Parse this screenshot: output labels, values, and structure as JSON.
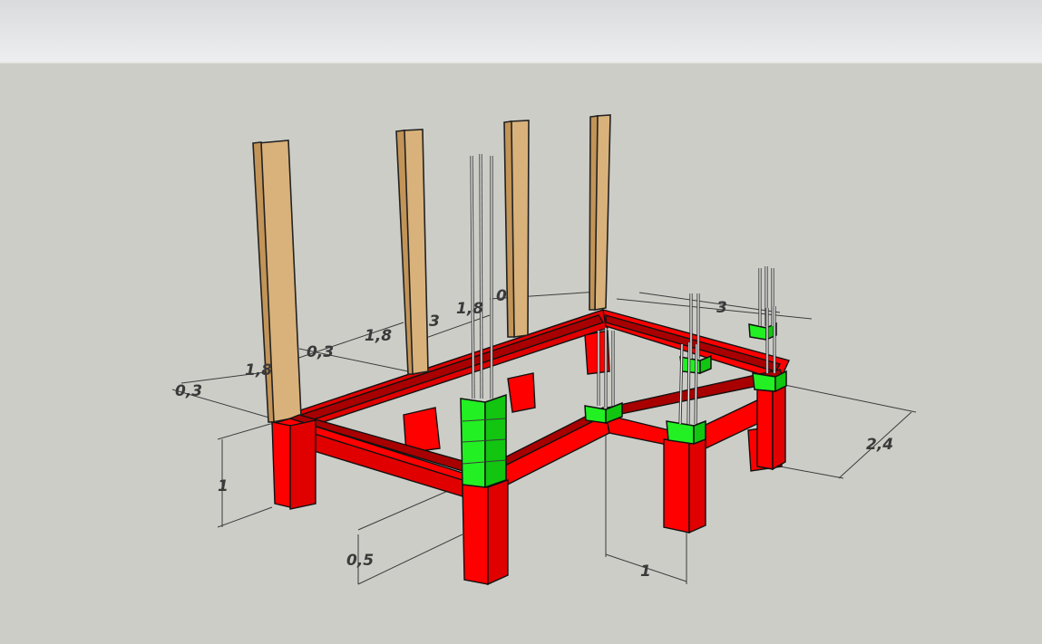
{
  "dimensions": {
    "height_1": "1",
    "depth_0_5": "0,5",
    "width_1": "1",
    "width_2_4": "2,4",
    "length_3": "3",
    "spacing_1_8_a": "1,8",
    "spacing_1_8_b": "1,8",
    "spacing_1_8_c": "1,8",
    "thickness_0_3_a": "0,3",
    "thickness_0_3_b": "0,3",
    "truncated_3": "3",
    "truncated_0": "0"
  },
  "colors": {
    "concrete": "#ff0000",
    "formwork_blocks": "#22f022",
    "timber_posts": "#d9b27b",
    "background": "#cdcdc8"
  }
}
